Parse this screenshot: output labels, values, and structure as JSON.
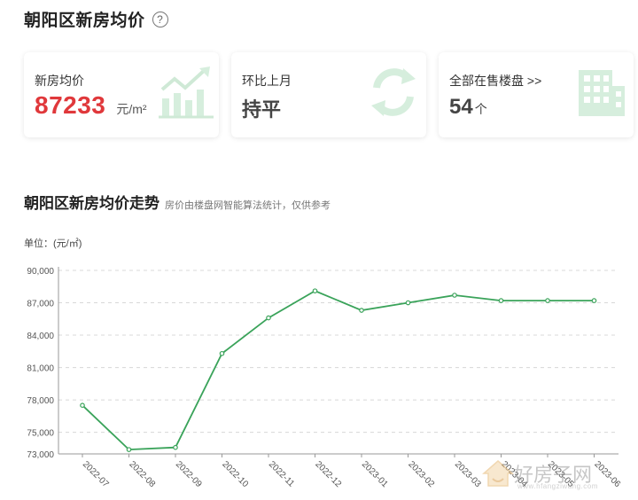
{
  "header": {
    "title": "朝阳区新房均价",
    "help_glyph": "?"
  },
  "cards": {
    "avg_price": {
      "label": "新房均价",
      "value": "87233",
      "unit": "元/m²",
      "icon": "rising-chart-icon"
    },
    "month_over_month": {
      "label": "环比上月",
      "value": "持平",
      "icon": "refresh-cycle-icon"
    },
    "listings": {
      "label": "全部在售楼盘 >>",
      "value": "54",
      "unit": "个",
      "icon": "building-icon"
    }
  },
  "section": {
    "title": "朝阳区新房均价走势",
    "subtitle": "房价由楼盘网智能算法统计，仅供参考",
    "unit_label": "单位：(元/㎡)"
  },
  "watermark": {
    "text": "好房子网",
    "url": "www.hfangziwang.com"
  },
  "colors": {
    "line": "#3aa35a",
    "accent_red": "#e0383b",
    "icon_green": "#cfe9d6",
    "grid": "#d8d8d8"
  },
  "chart_data": {
    "type": "line",
    "title": "朝阳区新房均价走势",
    "ylabel": "单位：(元/㎡)",
    "categories": [
      "2022-07",
      "2022-08",
      "2022-09",
      "2022-10",
      "2022-11",
      "2022-12",
      "2023-01",
      "2023-02",
      "2023-03",
      "2023-04",
      "2023-05",
      "2023-06"
    ],
    "tick_labels": [
      "2022-07",
      "2022-08",
      "2022-09",
      "2022-10",
      "2022-11",
      "2022-12",
      "2023-01",
      "2023-02",
      "2023-03",
      "2023-04",
      "2023-05",
      "2023-06"
    ],
    "values": [
      77500,
      73400,
      73600,
      82300,
      85600,
      88100,
      86300,
      87000,
      87700,
      87200,
      87200,
      87200
    ],
    "yticks": [
      73000,
      75000,
      78000,
      81000,
      84000,
      87000,
      90000
    ],
    "ytick_labels": [
      "73,000",
      "75,000",
      "78,000",
      "81,000",
      "84,000",
      "87,000",
      "90,000"
    ],
    "ylim": [
      73000,
      90000
    ],
    "grid": true
  }
}
